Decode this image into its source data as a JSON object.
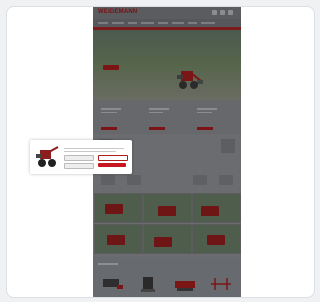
{
  "page": {
    "logo": "WEIDEMANN",
    "hero_title": "",
    "modal": {
      "heading": "",
      "buttons": {
        "settings": "",
        "decline": "",
        "accept": ""
      }
    }
  },
  "colors": {
    "brand_red": "#c8161d",
    "overlay_grey": "#6a6c70"
  },
  "icons": [
    "search-icon",
    "user-icon",
    "cart-icon"
  ]
}
